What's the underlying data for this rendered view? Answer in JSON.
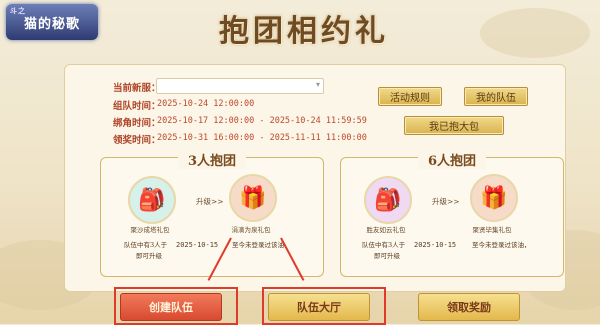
{
  "logo": {
    "top_text": "斗之",
    "main_text": "猫的秘歌"
  },
  "title": "抱团相约礼",
  "form": {
    "server_label": "当前新服：",
    "server_value": "",
    "team_time_label": "组队时间：",
    "team_time_value": "2025-10-24 12:00:00",
    "bind_time_label": "绑角时间：",
    "bind_time_value": "2025-10-17 12:00:00 - 2025-10-24 11:59:59",
    "claim_time_label": "领奖时间：",
    "claim_time_value": "2025-10-31 16:00:00 - 2025-11-11 11:00:00"
  },
  "buttons": {
    "rules": "活动规则",
    "my_team": "我的队伍",
    "go_bind": "我已抱大包"
  },
  "groups": [
    {
      "title": "3人抱团",
      "pack1_name": "聚沙成塔礼包",
      "upgrade": "升级>>",
      "pack2_name": "涓滴为泉礼包",
      "note1": "队伍中有3人于",
      "note1b": "即可升级",
      "date": "2025-10-15",
      "note2": "至今未登录过该油，"
    },
    {
      "title": "6人抱团",
      "pack1_name": "胜友如云礼包",
      "upgrade": "升级>>",
      "pack2_name": "聚贤毕集礼包",
      "note1": "队伍中有3人于",
      "note1b": "即可升级",
      "date": "2025-10-15",
      "note2": "至今未登录过该油，"
    }
  ],
  "bottom": {
    "create_team": "创建队伍",
    "team_hall": "队伍大厅",
    "claim_reward": "领取奖励"
  },
  "icons": {
    "pack_blue": "gift-bag-icon",
    "pack_red": "gift-bag-icon",
    "dropdown": "chevron-down-icon"
  },
  "colors": {
    "accent_red": "#e03a2a",
    "gold": "#e3b84c"
  }
}
